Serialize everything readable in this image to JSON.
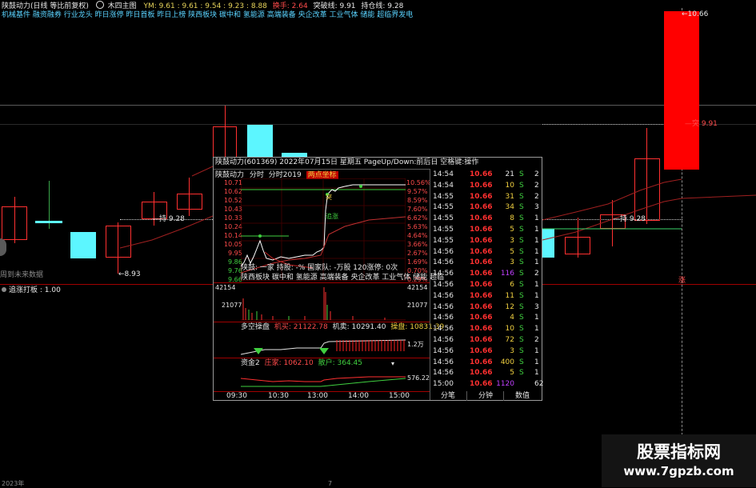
{
  "header": {
    "title": "陕鼓动力(日线 等比前复权)",
    "chart_icon_label": "木四主图",
    "ym_label": "YM: 9.61 : 9.61 : 9.54 : 9.23 : 8.88",
    "huanshou": "换手: 2.64",
    "tupo": "突破线: 9.91",
    "chicang": "持仓线: 9.28"
  },
  "concepts_bar": "机械基件 融资融券 行业龙头 昨日涨停 昨日首板 昨日上榜 陕西板块 碳中和 氢能源 高端装备 央企改革 工业气体 储能 超临界发电",
  "price_markers": {
    "high": "10.66",
    "tu": "突 9.91",
    "chi_left": "持 9.28",
    "chi_right": "持 9.28",
    "low": "8.93",
    "future_note": "周到未来数据",
    "indicator_label": "追涨打板 : 1.00",
    "zhang": "涨",
    "year_label": "2023年",
    "seven": "7"
  },
  "popup": {
    "title": "陕鼓动力(601369)  2022年07月15日 星期五 PageUp/Down:前后日 空格键:操作",
    "subtitle_name": "陕鼓动力",
    "subtitle_tabs": [
      "分时",
      "分时2019"
    ],
    "subtitle_active": "两点坐标",
    "left_axis": [
      "10.71",
      "10.62",
      "10.52",
      "10.43",
      "10.33",
      "10.24",
      "10.14",
      "10.05",
      "9.95",
      "9.86",
      "9.76",
      "9.66"
    ],
    "right_axis": [
      "10.56%",
      "9.57%",
      "8.59%",
      "7.60%",
      "6.62%",
      "5.63%",
      "4.64%",
      "3.66%",
      "2.67%",
      "1.69%",
      "0.70%",
      "0.29%"
    ],
    "info_line": "陕鼓: 一家 持股: -% 国家队: -万股 120涨停: 0次",
    "concept_line": "陕西板块 碳中和 氢能源 高端装备 央企改革 工业气体 储能 超临",
    "vol_max": "42154",
    "vol_mid": "21077",
    "duokong": "多空操盘",
    "jimai": "机买: 21122.78",
    "jimai2": "机卖: 10291.40",
    "caopan": "操盘: 10831.39",
    "jin_val": "1.2万",
    "zijin": "资金2",
    "zhuli": "庄家: 1062.10",
    "sanhu": "散户: 364.45",
    "zijin_val": "576.22",
    "time_labels": [
      "09:30",
      "10:30",
      "13:00",
      "14:00",
      "15:00"
    ],
    "label_chuan": "追涨",
    "label_tu": "突"
  },
  "ticks": [
    {
      "time": "14:54",
      "price": "10.66",
      "vol": "21",
      "side": "S",
      "cnt": "2",
      "vc": "w"
    },
    {
      "time": "14:54",
      "price": "10.66",
      "vol": "10",
      "side": "S",
      "cnt": "2",
      "vc": "y"
    },
    {
      "time": "14:55",
      "price": "10.66",
      "vol": "31",
      "side": "S",
      "cnt": "2",
      "vc": "y"
    },
    {
      "time": "14:55",
      "price": "10.66",
      "vol": "34",
      "side": "S",
      "cnt": "3",
      "vc": "y"
    },
    {
      "time": "14:55",
      "price": "10.66",
      "vol": "8",
      "side": "S",
      "cnt": "1",
      "vc": "y"
    },
    {
      "time": "14:55",
      "price": "10.66",
      "vol": "5",
      "side": "S",
      "cnt": "1",
      "vc": "y"
    },
    {
      "time": "14:55",
      "price": "10.66",
      "vol": "3",
      "side": "S",
      "cnt": "1",
      "vc": "y"
    },
    {
      "time": "14:56",
      "price": "10.66",
      "vol": "5",
      "side": "S",
      "cnt": "1",
      "vc": "y"
    },
    {
      "time": "14:56",
      "price": "10.66",
      "vol": "3",
      "side": "S",
      "cnt": "1",
      "vc": "y"
    },
    {
      "time": "14:56",
      "price": "10.66",
      "vol": "116",
      "side": "S",
      "cnt": "2",
      "vc": "p"
    },
    {
      "time": "14:56",
      "price": "10.66",
      "vol": "6",
      "side": "S",
      "cnt": "1",
      "vc": "y"
    },
    {
      "time": "14:56",
      "price": "10.66",
      "vol": "11",
      "side": "S",
      "cnt": "1",
      "vc": "y"
    },
    {
      "time": "14:56",
      "price": "10.66",
      "vol": "12",
      "side": "S",
      "cnt": "3",
      "vc": "y"
    },
    {
      "time": "14:56",
      "price": "10.66",
      "vol": "4",
      "side": "S",
      "cnt": "1",
      "vc": "y"
    },
    {
      "time": "14:56",
      "price": "10.66",
      "vol": "10",
      "side": "S",
      "cnt": "1",
      "vc": "y"
    },
    {
      "time": "14:56",
      "price": "10.66",
      "vol": "72",
      "side": "S",
      "cnt": "2",
      "vc": "y"
    },
    {
      "time": "14:56",
      "price": "10.66",
      "vol": "3",
      "side": "S",
      "cnt": "1",
      "vc": "y"
    },
    {
      "time": "14:56",
      "price": "10.66",
      "vol": "400",
      "side": "S",
      "cnt": "1",
      "vc": "y"
    },
    {
      "time": "14:56",
      "price": "10.66",
      "vol": "5",
      "side": "S",
      "cnt": "1",
      "vc": "y"
    },
    {
      "time": "15:00",
      "price": "10.66",
      "vol": "1120",
      "side": "",
      "cnt": "62",
      "vc": "p"
    }
  ],
  "tabs": [
    "分笔",
    "分钟",
    "数值"
  ],
  "watermark": {
    "line1": "股票指标网",
    "line2": "www.7gpzb.com"
  },
  "colors": {
    "up": "#ff3030",
    "down": "#5cf6ff",
    "accent": "#5ad3ff",
    "bg": "#000000"
  }
}
